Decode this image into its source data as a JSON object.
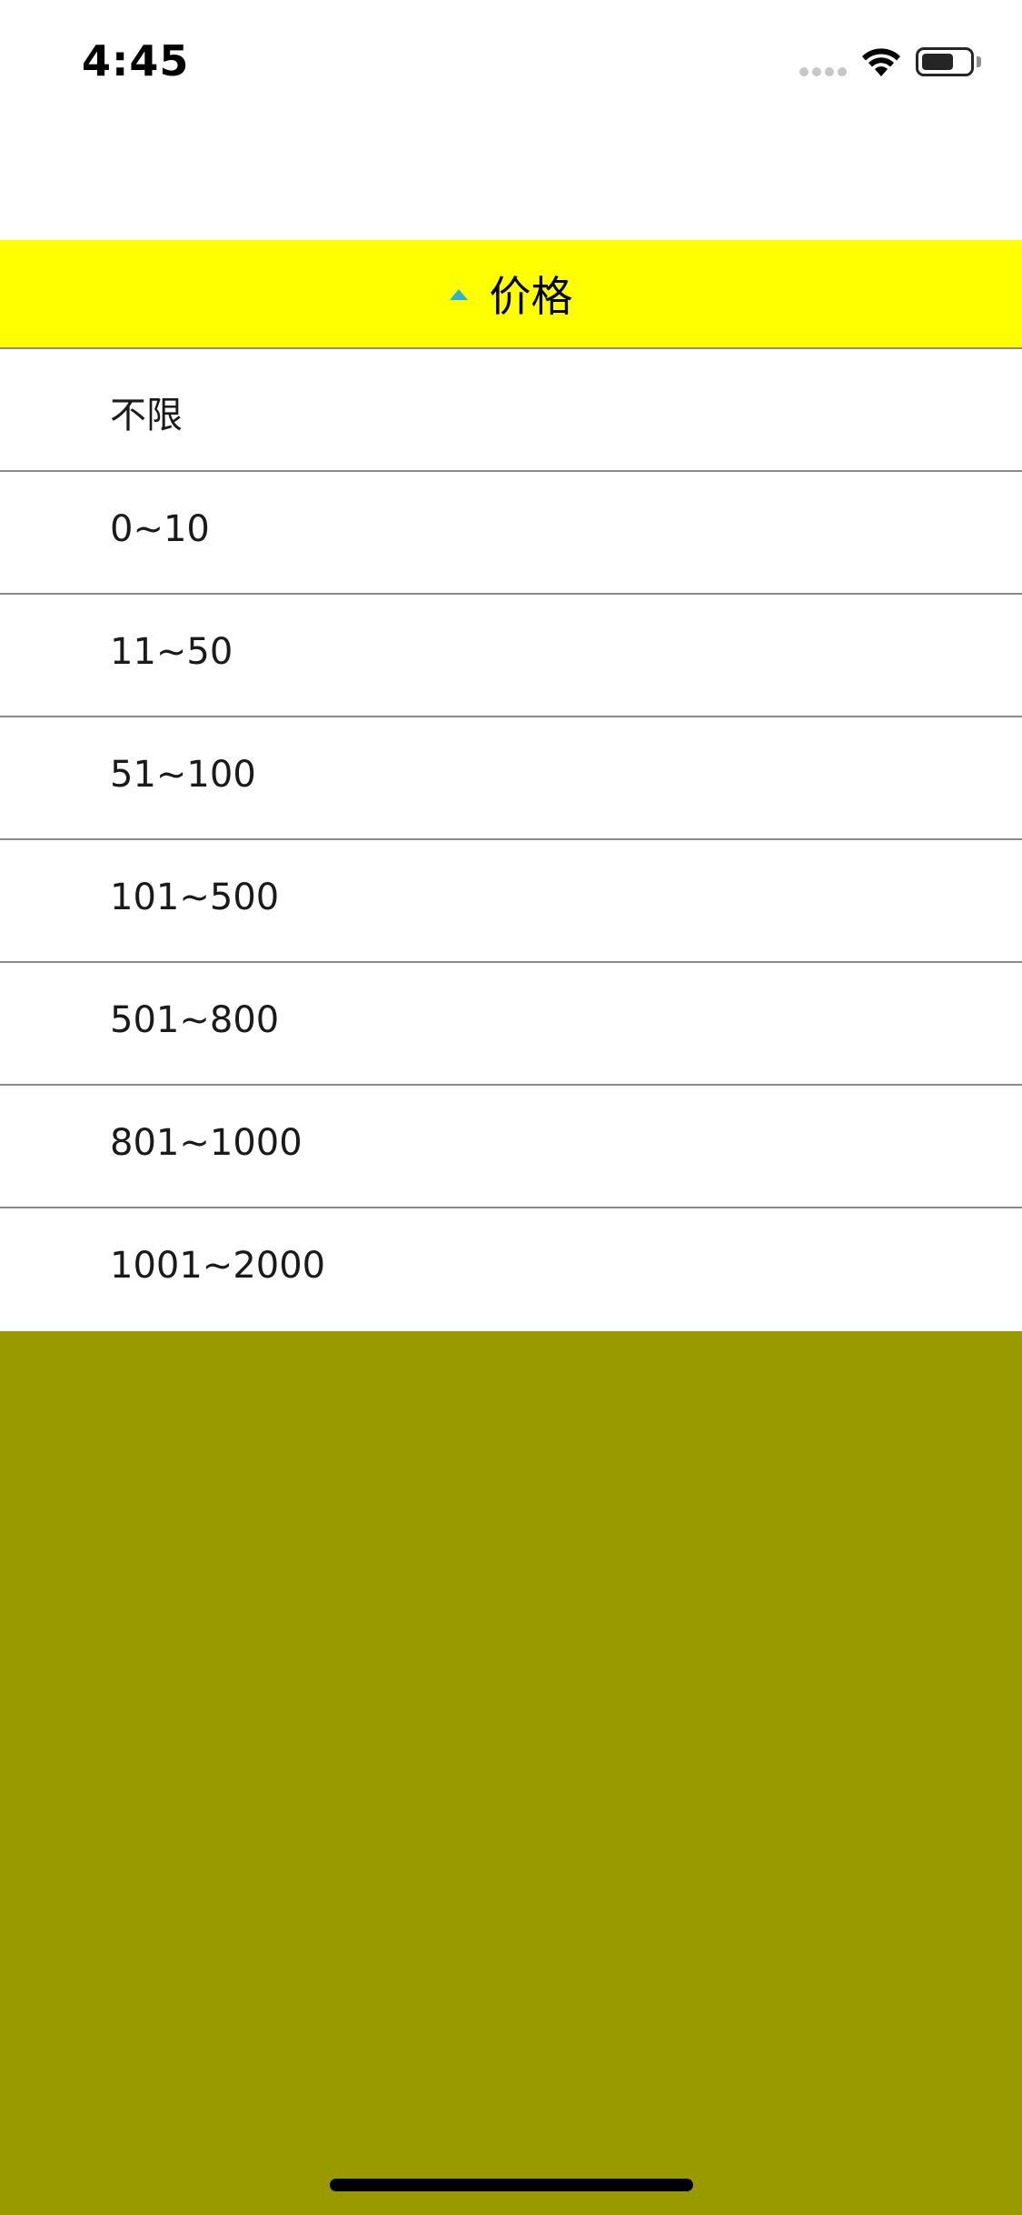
{
  "status_bar": {
    "time": "4:45",
    "icons": [
      "signal-dots-icon",
      "wifi-icon",
      "battery-icon"
    ]
  },
  "filter": {
    "header_label": "价格",
    "header_icon": "caret-up-icon",
    "options": [
      {
        "label": "不限"
      },
      {
        "label": "0~10"
      },
      {
        "label": "11~50"
      },
      {
        "label": "51~100"
      },
      {
        "label": "101~500"
      },
      {
        "label": "501~800"
      },
      {
        "label": "801~1000"
      },
      {
        "label": "1001~2000"
      }
    ]
  },
  "colors": {
    "header_background": "#ffff00",
    "caret": "#2bb3d6",
    "overlay": "#999a00",
    "separator": "#8a8a8a",
    "list_background": "#ffffff"
  }
}
